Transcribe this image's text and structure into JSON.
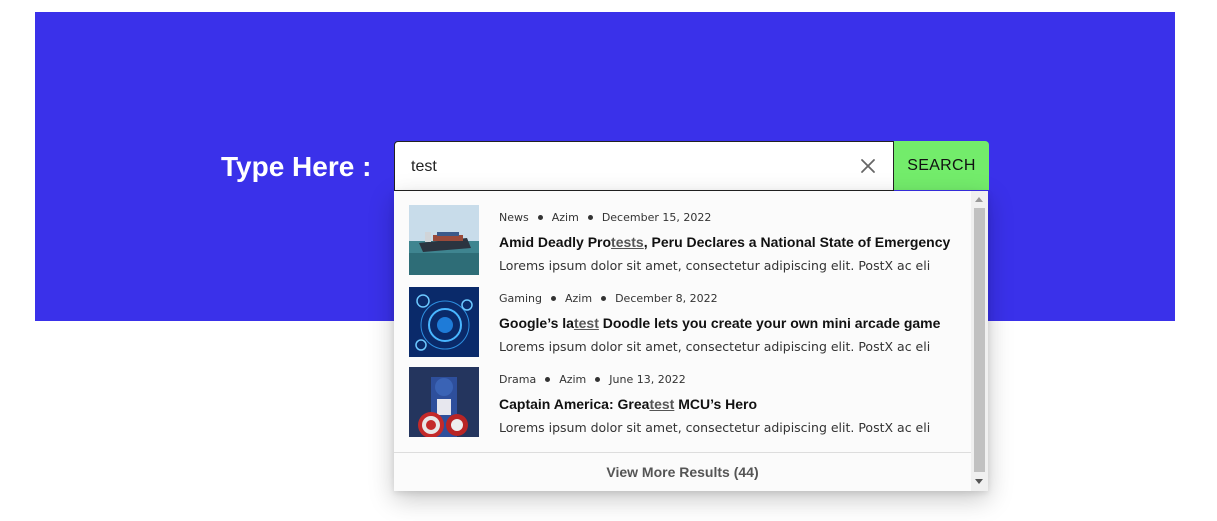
{
  "hero": {
    "background": "#3a31ea"
  },
  "search": {
    "label": "Type Here :",
    "value": "test",
    "button_label": "SEARCH",
    "button_color": "#73ec6b",
    "clear_icon": "close-icon"
  },
  "results": [
    {
      "category": "News",
      "author": "Azim",
      "date": "December 15, 2022",
      "title_before": "Amid Deadly Pro",
      "title_match": "tests",
      "title_after": ", Peru Declares a National State of Emergency",
      "excerpt": "Lorems ipsum dolor sit amet, consectetur adipiscing elit. PostX ac eli",
      "thumbnail": "cargo-ship-image"
    },
    {
      "category": "Gaming",
      "author": "Azim",
      "date": "December 8, 2022",
      "title_before": "Google’s la",
      "title_match": "test",
      "title_after": " Doodle lets you create your own mini arcade game",
      "excerpt": "Lorems ipsum dolor sit amet, consectetur adipiscing elit. PostX ac eli",
      "thumbnail": "tech-hologram-image"
    },
    {
      "category": "Drama",
      "author": "Azim",
      "date": "June 13, 2022",
      "title_before": "Captain America: Grea",
      "title_match": "test",
      "title_after": " MCU’s Hero",
      "excerpt": "Lorems ipsum dolor sit amet, consectetur adipiscing elit. PostX ac eli",
      "thumbnail": "captain-america-image"
    }
  ],
  "more_results": "View More Results (44)"
}
